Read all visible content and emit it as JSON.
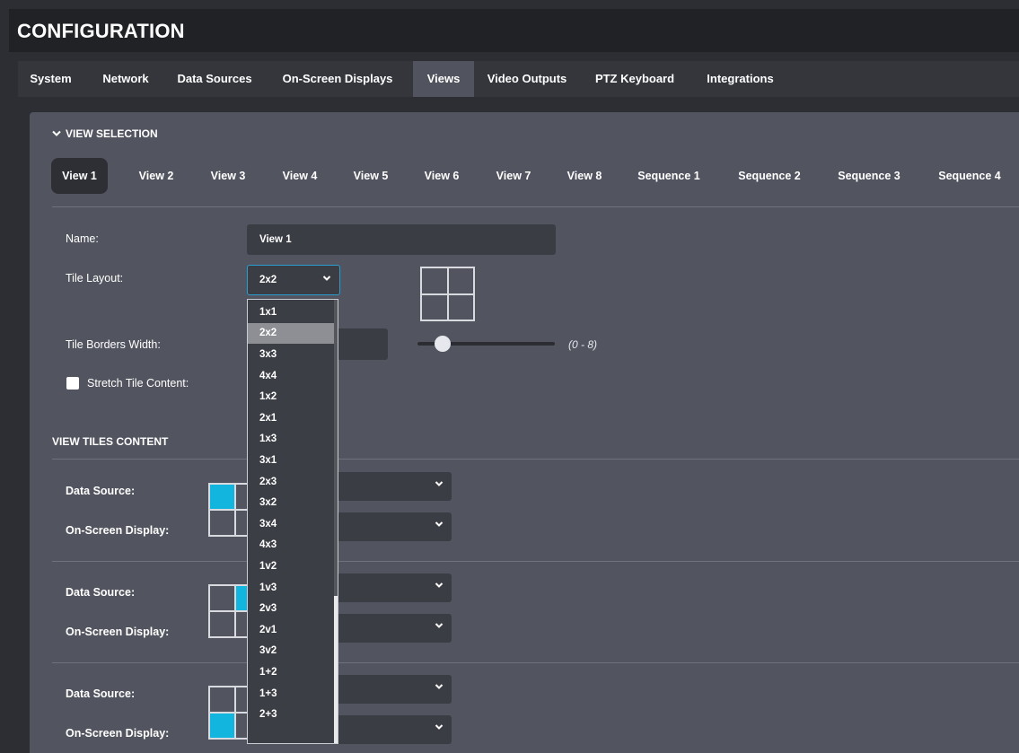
{
  "app": {
    "title": "CONFIGURATION"
  },
  "nav_tabs": [
    {
      "label": "System",
      "active": false
    },
    {
      "label": "Network",
      "active": false
    },
    {
      "label": "Data Sources",
      "active": false
    },
    {
      "label": "On-Screen Displays",
      "active": false
    },
    {
      "label": "Views",
      "active": true
    },
    {
      "label": "Video Outputs",
      "active": false
    },
    {
      "label": "PTZ Keyboard",
      "active": false
    },
    {
      "label": "Integrations",
      "active": false
    }
  ],
  "view_selection": {
    "heading": "VIEW SELECTION",
    "tabs": [
      {
        "label": "View 1",
        "active": true
      },
      {
        "label": "View 2"
      },
      {
        "label": "View 3"
      },
      {
        "label": "View 4"
      },
      {
        "label": "View 5"
      },
      {
        "label": "View 6"
      },
      {
        "label": "View 7"
      },
      {
        "label": "View 8"
      },
      {
        "label": "Sequence 1"
      },
      {
        "label": "Sequence 2"
      },
      {
        "label": "Sequence 3"
      },
      {
        "label": "Sequence 4"
      }
    ]
  },
  "form": {
    "name_label": "Name:",
    "name_value": "View 1",
    "tile_layout_label": "Tile Layout:",
    "tile_layout_value": "2x2",
    "tile_borders_label": "Tile Borders Width:",
    "tile_borders_range": "(0 - 8)",
    "tile_borders_fraction": 0.125,
    "stretch_label": "Stretch Tile Content:",
    "stretch_checked": false
  },
  "layout_options": [
    "1x1",
    "2x2",
    "3x3",
    "4x4",
    "1x2",
    "2x1",
    "1x3",
    "3x1",
    "2x3",
    "3x2",
    "3x4",
    "4x3",
    "1v2",
    "1v3",
    "2v3",
    "2v1",
    "3v2",
    "1+2",
    "1+3",
    "2+3"
  ],
  "layout_selected": "2x2",
  "tiles_content": {
    "heading": "VIEW TILES CONTENT",
    "data_source_label": "Data Source:",
    "osd_label": "On-Screen Display:",
    "tiles": [
      {
        "highlight": 0
      },
      {
        "highlight": 1
      },
      {
        "highlight": 2
      }
    ]
  },
  "colors": {
    "accent": "#12b5de",
    "panel": "#52555f",
    "background": "#2c2e34"
  },
  "icons": {
    "chevron": "chevron-down-icon",
    "caret": "caret-down-icon"
  }
}
